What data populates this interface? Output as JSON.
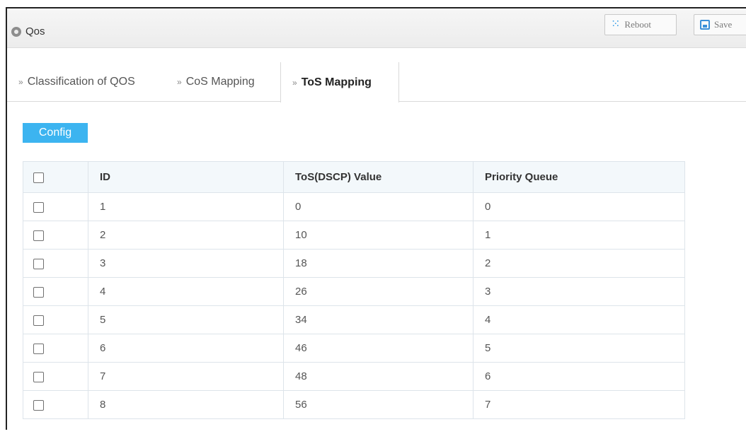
{
  "window": {
    "title": "Qos",
    "reboot_label": "Reboot",
    "save_label": "Save"
  },
  "tabs": [
    {
      "label": "Classification of QOS",
      "active": false
    },
    {
      "label": "CoS Mapping",
      "active": false
    },
    {
      "label": "ToS Mapping",
      "active": true
    }
  ],
  "toolbar": {
    "config_label": "Config"
  },
  "table": {
    "headers": {
      "id": "ID",
      "tos": "ToS(DSCP) Value",
      "queue": "Priority Queue"
    },
    "rows": [
      {
        "id": "1",
        "tos": "0",
        "queue": "0"
      },
      {
        "id": "2",
        "tos": "10",
        "queue": "1"
      },
      {
        "id": "3",
        "tos": "18",
        "queue": "2"
      },
      {
        "id": "4",
        "tos": "26",
        "queue": "3"
      },
      {
        "id": "5",
        "tos": "34",
        "queue": "4"
      },
      {
        "id": "6",
        "tos": "46",
        "queue": "5"
      },
      {
        "id": "7",
        "tos": "48",
        "queue": "6"
      },
      {
        "id": "8",
        "tos": "56",
        "queue": "7"
      }
    ]
  },
  "colors": {
    "accent": "#3cb4f0",
    "header_bg": "#f3f8fb",
    "titlebar_bg": "#ececec",
    "reboot_icon": "#3aa0e8",
    "save_icon": "#3a8fd8"
  },
  "icons": {
    "title": "location-dot-icon",
    "reboot": "loading-spinner-icon",
    "save": "floppy-disk-icon",
    "tab": "double-chevron-right-icon"
  }
}
